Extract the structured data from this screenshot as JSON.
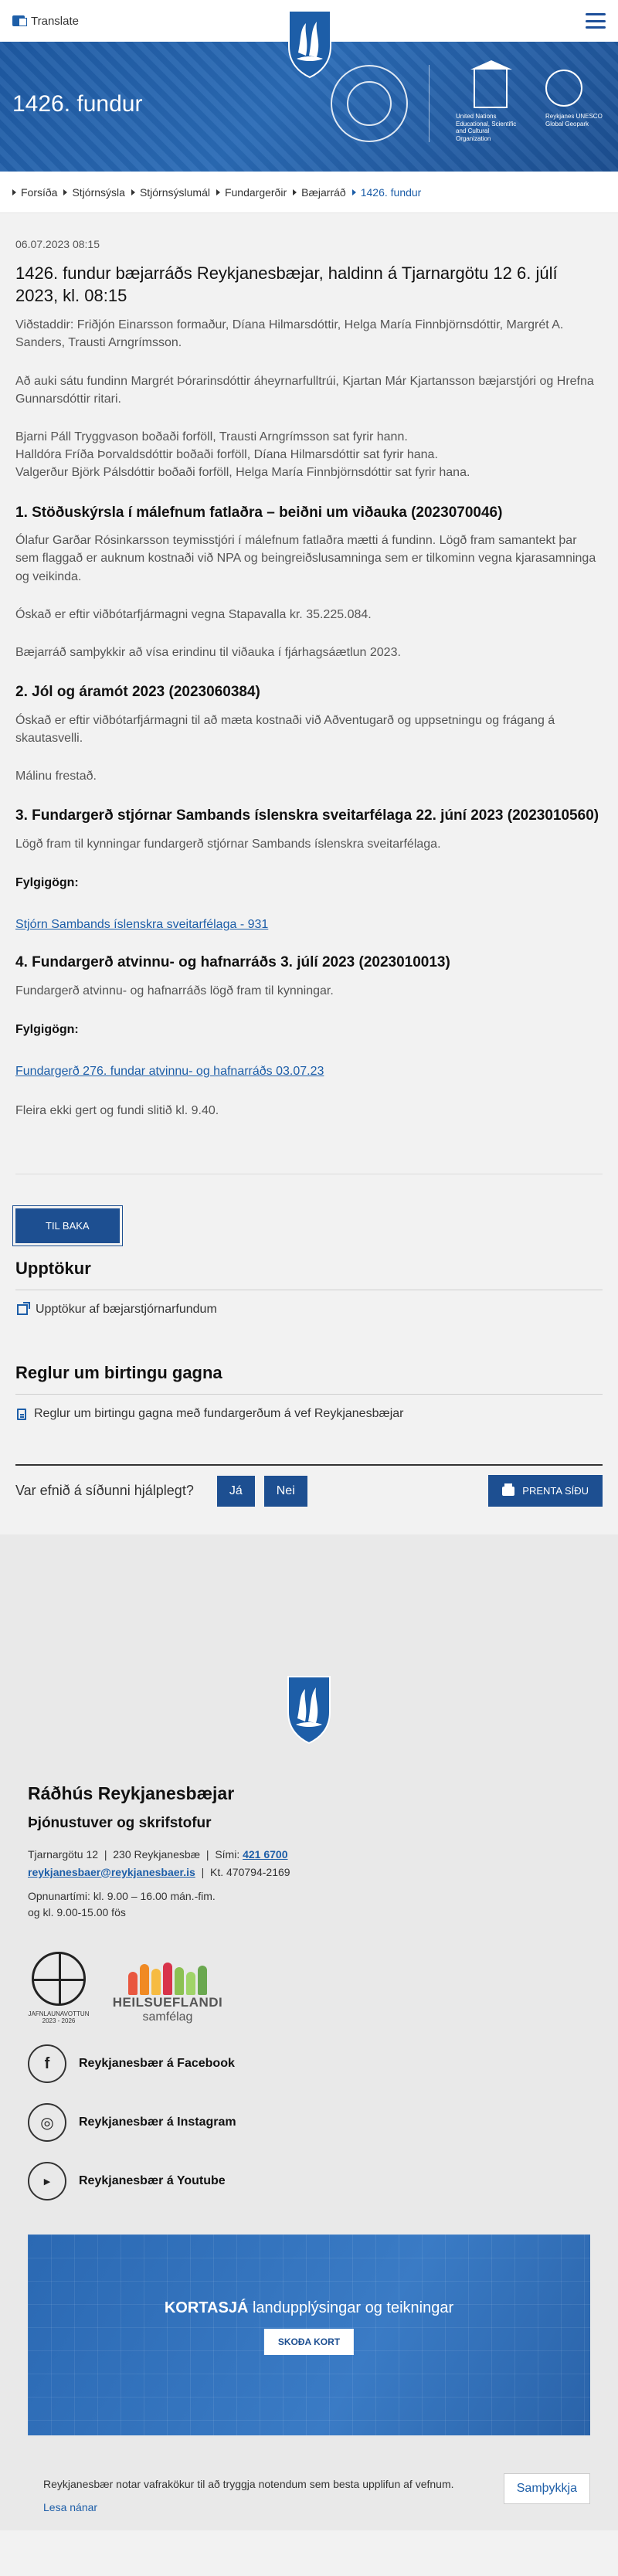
{
  "header": {
    "translate_label": "Translate",
    "menu_icon": "hamburger-icon"
  },
  "hero": {
    "title": "1426. fundur",
    "geopark_text": "Reykjanes UNESCO Global Geopark",
    "unesco_text": "United Nations Educational, Scientific and Cultural Organization",
    "unesco_sub": "Reykjanes UNESCO Global Geopark"
  },
  "breadcrumb": [
    "Forsíða",
    "Stjórnsýsla",
    "Stjórnsýslumál",
    "Fundargerðir",
    "Bæjarráð",
    "1426. fundur"
  ],
  "meeting": {
    "date": "06.07.2023 08:15",
    "title": "1426. fundur bæjarráðs Reykjanesbæjar, haldinn á Tjarnargötu 12 6. júlí 2023, kl. 08:15",
    "attendance": "Viðstaddir: Friðjón Einarsson formaður, Díana Hilmarsdóttir, Helga María Finnbjörnsdóttir, Margrét A. Sanders, Trausti Arngrímsson.",
    "also_present": "Að auki sátu fundinn Margrét Þórarinsdóttir áheyrnarfulltrúi, Kjartan Már Kjartansson bæjarstjóri og Hrefna Gunnarsdóttir ritari.",
    "absences": [
      "Bjarni Páll Tryggvason boðaði forföll, Trausti Arngrímsson sat fyrir hann.",
      "Halldóra Fríða Þorvaldsdóttir boðaði forföll, Díana Hilmarsdóttir sat fyrir hana.",
      "Valgerður Björk Pálsdóttir boðaði forföll, Helga María Finnbjörnsdóttir sat fyrir hana."
    ]
  },
  "items": {
    "i1": {
      "heading": "1. Stöðuskýrsla í málefnum fatlaðra – beiðni um viðauka (2023070046)",
      "p1": "Ólafur Garðar Rósinkarsson teymisstjóri í málefnum fatlaðra mætti á fundinn. Lögð fram samantekt þar sem flaggað er auknum kostnaði við NPA og beingreiðslusamninga sem er tilkominn vegna kjarasamninga og veikinda.",
      "p2": "Óskað er eftir viðbótarfjármagni vegna Stapavalla kr. 35.225.084.",
      "p3": "Bæjarráð samþykkir að vísa erindinu til viðauka í fjárhagsáætlun 2023."
    },
    "i2": {
      "heading": "2. Jól og áramót 2023 (2023060384)",
      "p1": "Óskað er eftir viðbótarfjármagni til að mæta kostnaði við Aðventugarð og uppsetningu og frágang á skautasvelli.",
      "p2": "Málinu frestað."
    },
    "i3": {
      "heading": "3. Fundargerð stjórnar Sambands íslenskra sveitarfélaga 22. júní 2023 (2023010560)",
      "p1": "Lögð fram til kynningar fundargerð stjórnar Sambands íslenskra sveitarfélaga.",
      "attachments_label": "Fylgigögn:",
      "link": "Stjórn Sambands íslenskra sveitarfélaga - 931"
    },
    "i4": {
      "heading": "4. Fundargerð atvinnu- og hafnarráðs 3. júlí 2023 (2023010013)",
      "p1": "Fundargerð atvinnu- og hafnarráðs lögð fram til kynningar.",
      "attachments_label": "Fylgigögn:",
      "link": "Fundargerð 276. fundar atvinnu- og hafnarráðs 03.07.23"
    },
    "closing": "Fleira ekki gert og fundi slitið kl. 9.40."
  },
  "actions": {
    "back_label": "TIL BAKA"
  },
  "recordings": {
    "heading": "Upptökur",
    "link": "Upptökur af bæjarstjórnarfundum"
  },
  "rules": {
    "heading": "Reglur um birtingu gagna",
    "link": "Reglur um birtingu gagna með fundargerðum á vef Reykjanesbæjar"
  },
  "feedback": {
    "question": "Var efnið á síðunni hjálplegt?",
    "yes": "Já",
    "no": "Nei",
    "print": "PRENTA SÍÐU"
  },
  "footer": {
    "title": "Ráðhús Reykjanesbæjar",
    "subtitle": "Þjónustuver og skrifstofur",
    "address": "Tjarnargötu 12",
    "postal": "230 Reykjanesbæ",
    "phone_label": "Sími:",
    "phone": "421 6700",
    "email": "reykjanesbaer@reykjanesbaer.is",
    "kt": "Kt. 470794-2169",
    "hours_1": "Opnunartími:  kl. 9.00 – 16.00 mán.-fim.",
    "hours_2": "og kl. 9.00-15.00 fös",
    "jafn_label_1": "JAFNLAUNAVOTTUN",
    "jafn_label_2": "2023 - 2026",
    "heilsu_1": "HEILSUEFLANDI",
    "heilsu_2": "samfélag",
    "social": [
      {
        "label": "Reykjanesbær á Facebook",
        "icon": "facebook-icon"
      },
      {
        "label": "Reykjanesbær á Instagram",
        "icon": "instagram-icon"
      },
      {
        "label": "Reykjanesbær á Youtube",
        "icon": "youtube-icon"
      }
    ],
    "map_heading_bold": "KORTASJÁ",
    "map_heading_rest": " landupplýsingar og teikningar",
    "map_button": "SKOÐA KORT"
  },
  "cookie": {
    "text": "Reykjanesbær notar vafrakökur til að tryggja notendum sem besta upplifun af vefnum.",
    "read_more": "Lesa nánar",
    "accept": "Samþykkja"
  },
  "colors": {
    "brand_blue": "#1d4f91",
    "link_blue": "#1d5ea8"
  }
}
